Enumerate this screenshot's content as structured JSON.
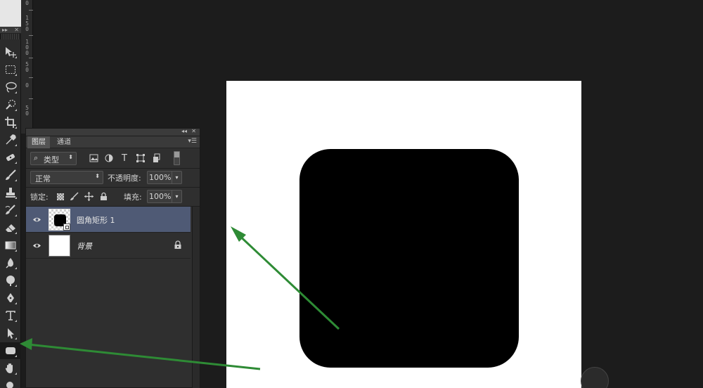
{
  "window": {
    "collapse_glyph": "◂◂",
    "close_glyph": "✕"
  },
  "ruler": {
    "ticks": [
      "0",
      "1\n5\n0",
      "1\n0\n0",
      "5\n0",
      "0",
      "5\n0"
    ]
  },
  "toolbox": {
    "tools": [
      {
        "name": "move-tool",
        "icon": "move-icon"
      },
      {
        "name": "marquee-tool",
        "icon": "marquee-icon"
      },
      {
        "name": "lasso-tool",
        "icon": "lasso-icon"
      },
      {
        "name": "quick-select-tool",
        "icon": "quick-select-icon"
      },
      {
        "name": "crop-tool",
        "icon": "crop-icon"
      },
      {
        "name": "eyedropper-tool",
        "icon": "eyedropper-icon"
      },
      {
        "name": "healing-tool",
        "icon": "healing-icon"
      },
      {
        "name": "brush-tool",
        "icon": "brush-icon"
      },
      {
        "name": "stamp-tool",
        "icon": "stamp-icon"
      },
      {
        "name": "history-brush-tool",
        "icon": "history-brush-icon"
      },
      {
        "name": "eraser-tool",
        "icon": "eraser-icon"
      },
      {
        "name": "gradient-tool",
        "icon": "gradient-icon"
      },
      {
        "name": "blur-tool",
        "icon": "blur-icon"
      },
      {
        "name": "dodge-tool",
        "icon": "dodge-icon"
      },
      {
        "name": "pen-tool",
        "icon": "pen-icon"
      },
      {
        "name": "type-tool",
        "icon": "type-icon"
      },
      {
        "name": "path-select-tool",
        "icon": "path-select-icon"
      },
      {
        "name": "shape-tool",
        "icon": "rounded-rect-icon"
      },
      {
        "name": "hand-tool",
        "icon": "hand-icon"
      }
    ]
  },
  "layers_panel": {
    "tabs": [
      {
        "label": "图层",
        "active": true
      },
      {
        "label": "通道",
        "active": false
      }
    ],
    "filter": {
      "label": "类型"
    },
    "blend_mode": {
      "value": "正常"
    },
    "opacity": {
      "label": "不透明度:",
      "value": "100%"
    },
    "lock": {
      "label": "锁定:"
    },
    "fill": {
      "label": "填充:",
      "value": "100%"
    },
    "layers": [
      {
        "name": "圆角矩形 1",
        "selected": true,
        "italic": false
      },
      {
        "name": "背景",
        "selected": false,
        "italic": true,
        "locked": true
      }
    ]
  },
  "canvas": {
    "background": "#ffffff",
    "shape_color": "#000000"
  },
  "annotations": {
    "arrow_color": "#2e8b35"
  }
}
